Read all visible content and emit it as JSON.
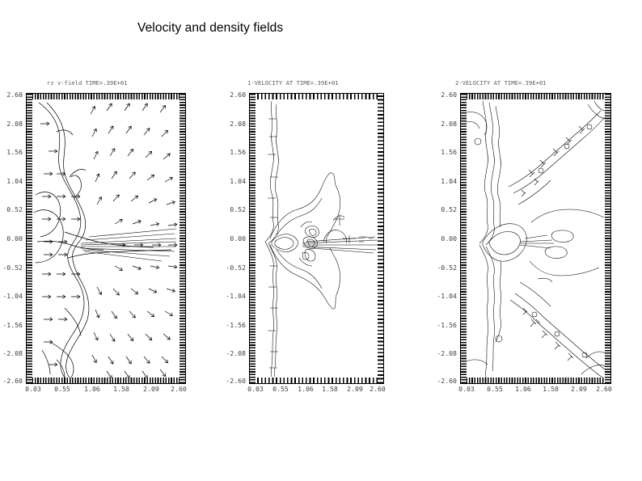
{
  "slide": {
    "title": "Velocity and density fields",
    "background_color": "#ffffff",
    "foreground_color": "#000000"
  },
  "plots": [
    {
      "id": "density-velocity-field",
      "title": "rz v-field TIME=.39E+01",
      "kind": "quiver-contour",
      "y_tick_labels": [
        "2.60",
        "2.08",
        "1.56",
        "1.04",
        "0.52",
        "0.00",
        "-0.52",
        "-1.04",
        "-1.56",
        "-2.08",
        "-2.60"
      ],
      "x_tick_labels": [
        "0.03",
        "0.55",
        "1.06",
        "1.58",
        "2.09",
        "2.60"
      ]
    },
    {
      "id": "velocity-component-1",
      "title": "1-VELOCITY AT TIME=.39E+01",
      "kind": "contour",
      "y_tick_labels": [
        "2.60",
        "2.08",
        "1.56",
        "1.04",
        "0.52",
        "0.00",
        "-0.52",
        "-1.04",
        "-1.56",
        "-2.08",
        "-2.60"
      ],
      "x_tick_labels": [
        "0.03",
        "0.55",
        "1.06",
        "1.58",
        "2.09",
        "2.60"
      ]
    },
    {
      "id": "velocity-component-2",
      "title": "2-VELOCITY AT TIME=.39E+01",
      "kind": "contour",
      "y_tick_labels": [
        "2.60",
        "2.08",
        "1.56",
        "1.04",
        "0.52",
        "0.00",
        "-0.52",
        "-1.04",
        "-1.56",
        "-2.08",
        "-2.60"
      ],
      "x_tick_labels": [
        "0.03",
        "0.55",
        "1.06",
        "1.58",
        "2.09",
        "2.60"
      ]
    }
  ],
  "chart_data": {
    "type": "line",
    "title": "Velocity and density fields",
    "panels": [
      {
        "name": "rz v-field TIME=.39E+01",
        "type": "quiver",
        "xlabel": "",
        "ylabel": "",
        "xlim": [
          0.03,
          2.6
        ],
        "ylim": [
          -2.6,
          2.6
        ],
        "xticks": [
          0.03,
          0.55,
          1.06,
          1.58,
          2.09,
          2.6
        ],
        "yticks": [
          2.6,
          2.08,
          1.56,
          1.04,
          0.52,
          0.0,
          -0.52,
          -1.04,
          -1.56,
          -2.08,
          -2.6
        ],
        "grid": false,
        "legend": "none",
        "description": "Velocity vector (quiver) field overlaid on density contour lines; arrows converge toward a jet along the mid-plane at y=0 and point outward/downstream on the right half of the domain."
      },
      {
        "name": "1-VELOCITY AT TIME=.39E+01",
        "type": "contour",
        "xlabel": "",
        "ylabel": "",
        "xlim": [
          0.03,
          2.6
        ],
        "ylim": [
          -2.6,
          2.6
        ],
        "xticks": [
          0.03,
          0.55,
          1.06,
          1.58,
          2.09,
          2.6
        ],
        "yticks": [
          2.6,
          2.08,
          1.56,
          1.04,
          0.52,
          0.0,
          -0.52,
          -1.04,
          -1.56,
          -2.08,
          -2.6
        ],
        "grid": false,
        "legend": "none",
        "description": "Contour lines of the axial (1-) velocity component: a vertical contour band near the left edge and a diamond/kite shaped closed contour family centred on y=0 with a narrow horizontal jet extending to the right boundary."
      },
      {
        "name": "2-VELOCITY AT TIME=.39E+01",
        "type": "contour",
        "xlabel": "",
        "ylabel": "",
        "xlim": [
          0.03,
          2.6
        ],
        "ylim": [
          -2.6,
          2.6
        ],
        "xticks": [
          0.03,
          0.55,
          1.06,
          1.58,
          2.09,
          2.6
        ],
        "yticks": [
          2.6,
          2.08,
          1.56,
          1.04,
          0.52,
          0.0,
          -0.52,
          -1.04,
          -1.56,
          -2.08,
          -2.6
        ],
        "grid": false,
        "legend": "none",
        "description": "Contour lines of the radial (2-) velocity component: near-vertical contour bundle at small x, a closed lens around the origin, and two oblique contour trains running to the upper-right and lower-right corners."
      }
    ]
  }
}
